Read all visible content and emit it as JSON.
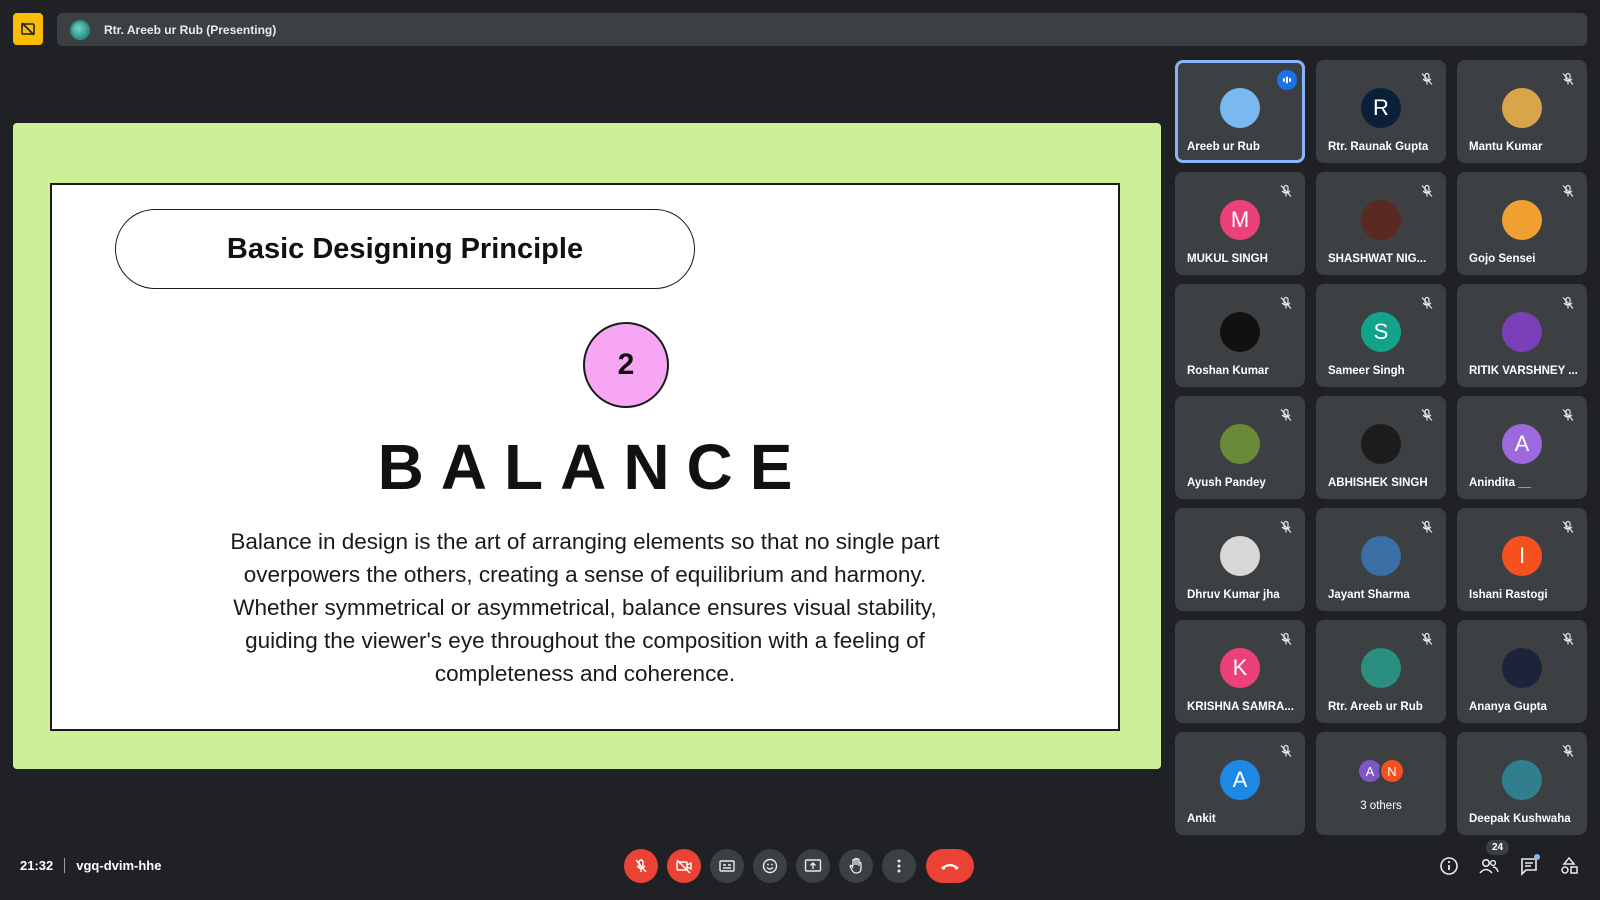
{
  "presenter_bar": {
    "text": "Rtr. Areeb ur Rub (Presenting)"
  },
  "slide": {
    "title": "Basic Designing Principle",
    "number": "2",
    "heading": "BALANCE",
    "body": "Balance in design is the art of arranging elements so that no single part overpowers the others, creating a sense of equilibrium and harmony. Whether symmetrical or asymmetrical, balance ensures visual stability, guiding the viewer's eye throughout the composition with a feeling of completeness and coherence.",
    "colors": {
      "frame": "#cdef97",
      "number_circle": "#f7a6f4"
    }
  },
  "participants": [
    {
      "name": "Areeb ur Rub",
      "avatar": "",
      "avatar_color": "#7ab8f0",
      "speaking": true
    },
    {
      "name": "Rtr. Raunak Gupta",
      "avatar": "R",
      "avatar_color": "#0b1f3a",
      "muted": true
    },
    {
      "name": "Mantu Kumar",
      "avatar": "",
      "avatar_color": "#d9a54a",
      "muted": true
    },
    {
      "name": "MUKUL SINGH",
      "avatar": "M",
      "avatar_color": "#ec407a",
      "muted": true
    },
    {
      "name": "SHASHWAT NIG...",
      "avatar": "",
      "avatar_color": "#5a2a22",
      "muted": true
    },
    {
      "name": "Gojo Sensei",
      "avatar": "",
      "avatar_color": "#f0a030",
      "muted": true
    },
    {
      "name": "Roshan Kumar",
      "avatar": "",
      "avatar_color": "#111111",
      "muted": true
    },
    {
      "name": "Sameer Singh",
      "avatar": "S",
      "avatar_color": "#12a38b",
      "muted": true
    },
    {
      "name": "RITIK VARSHNEY ...",
      "avatar": "",
      "avatar_color": "#7b3fb8",
      "muted": true
    },
    {
      "name": "Ayush Pandey",
      "avatar": "",
      "avatar_color": "#6a8a3a",
      "muted": true
    },
    {
      "name": "ABHISHEK SINGH",
      "avatar": "",
      "avatar_color": "#1c1c1c",
      "muted": true
    },
    {
      "name": "Anindita __",
      "avatar": "A",
      "avatar_color": "#9c6ade",
      "muted": true
    },
    {
      "name": "Dhruv Kumar jha",
      "avatar": "",
      "avatar_color": "#d8d8d8",
      "muted": true
    },
    {
      "name": "Jayant Sharma",
      "avatar": "",
      "avatar_color": "#3a6ea5",
      "muted": true
    },
    {
      "name": "Ishani Rastogi",
      "avatar": "I",
      "avatar_color": "#f4511e",
      "muted": true
    },
    {
      "name": "KRISHNA SAMRA...",
      "avatar": "K",
      "avatar_color": "#ec407a",
      "muted": true
    },
    {
      "name": "Rtr. Areeb ur Rub",
      "avatar": "",
      "avatar_color": "#2a8f7e",
      "muted": true
    },
    {
      "name": "Ananya Gupta",
      "avatar": "",
      "avatar_color": "#1b2438",
      "muted": true
    },
    {
      "name": "Ankit",
      "avatar": "A",
      "avatar_color": "#1e88e5",
      "muted": true
    }
  ],
  "others_tile": {
    "label": "3 others",
    "avatars": [
      {
        "letter": "A",
        "color": "#7e57c2"
      },
      {
        "letter": "N",
        "color": "#f4511e"
      }
    ]
  },
  "last_participant": {
    "name": "Deepak Kushwaha",
    "avatar": "",
    "avatar_color": "#2f7f8f",
    "muted": true
  },
  "meeting": {
    "time": "21:32",
    "code": "vgq-dvim-hhe",
    "people_count": "24"
  },
  "controls": {
    "mic": "mic-off-icon",
    "camera": "camera-off-icon",
    "captions": "captions-icon",
    "emoji": "emoji-icon",
    "present": "present-screen-icon",
    "raise_hand": "raise-hand-icon",
    "more": "more-options-icon",
    "end_call": "end-call-icon"
  }
}
